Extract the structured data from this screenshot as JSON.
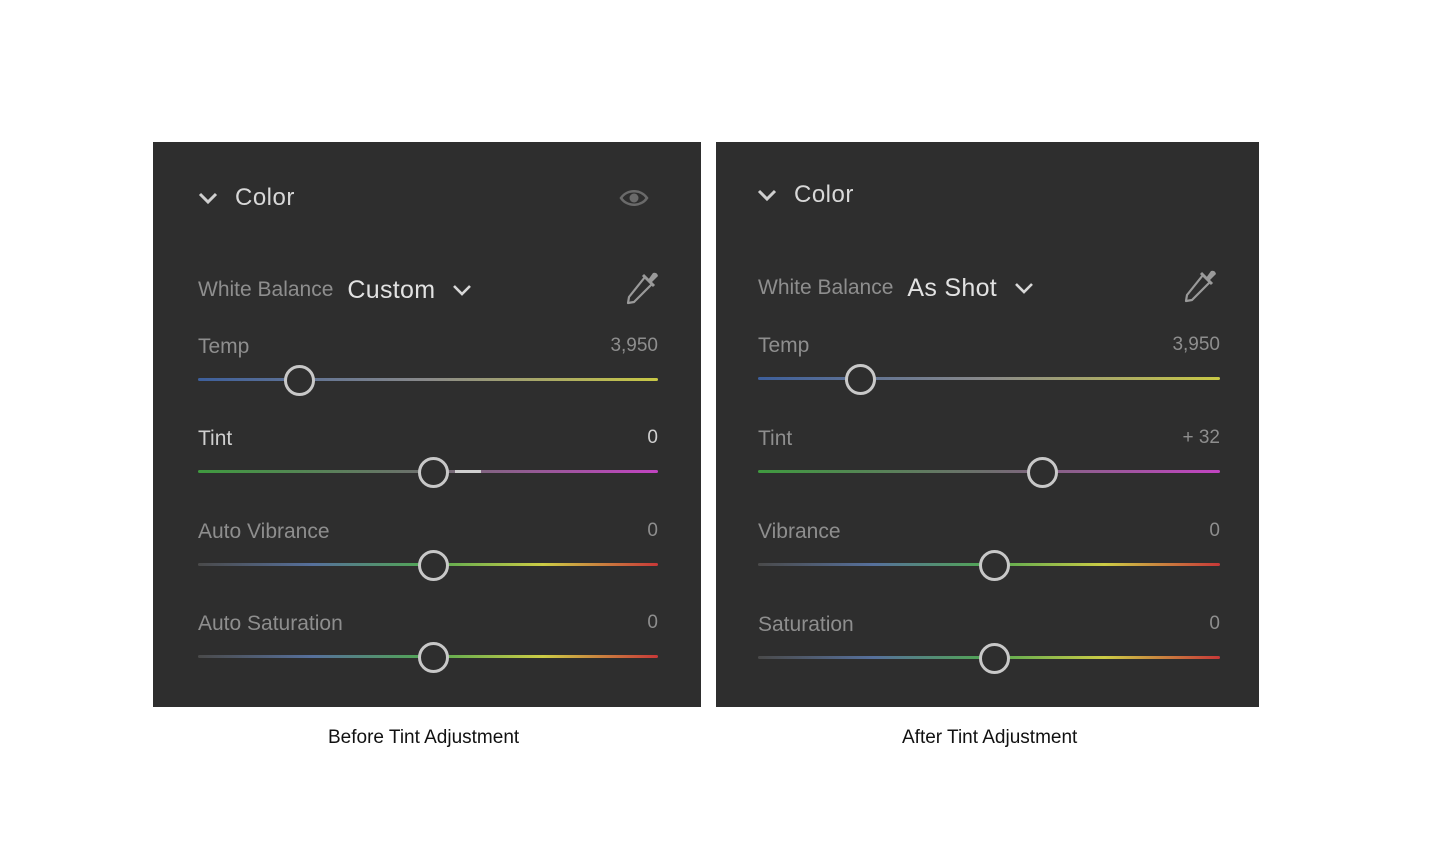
{
  "panels": [
    {
      "section_title": "Color",
      "white_balance": {
        "label": "White Balance",
        "value": "Custom"
      },
      "sliders": [
        {
          "label": "Temp",
          "value": "3,950",
          "position": 0.22,
          "bright": false
        },
        {
          "label": "Tint",
          "value": "0",
          "position": 0.51,
          "bright": true,
          "center_tick": true
        },
        {
          "label": "Auto Vibrance",
          "value": "0",
          "position": 0.51,
          "bright": false
        },
        {
          "label": "Auto Saturation",
          "value": "0",
          "position": 0.51,
          "bright": false
        }
      ],
      "caption": "Before Tint Adjustment"
    },
    {
      "section_title": "Color",
      "white_balance": {
        "label": "White Balance",
        "value": "As Shot"
      },
      "sliders": [
        {
          "label": "Temp",
          "value": "3,950",
          "position": 0.22,
          "bright": false
        },
        {
          "label": "Tint",
          "value": "+ 32",
          "position": 0.615,
          "bright": false
        },
        {
          "label": "Vibrance",
          "value": "0",
          "position": 0.51,
          "bright": false
        },
        {
          "label": "Saturation",
          "value": "0",
          "position": 0.51,
          "bright": false
        }
      ],
      "caption": "After Tint Adjustment"
    }
  ],
  "track_colors": {
    "temp": [
      "#3d5f9c",
      "#8a8a8a",
      "#c8c845"
    ],
    "tint": [
      "#3f9a3f",
      "#6e6e6e",
      "#c244c2"
    ],
    "vibrance": [
      "#4a4a4a",
      "#56709c",
      "#52a852",
      "#cccc45",
      "#c83838"
    ]
  },
  "icons": {
    "collapse": "chevron-down-icon",
    "visibility": "eye-icon",
    "white_balance_picker": "eyedropper-icon",
    "dropdown": "chevron-down-icon"
  }
}
